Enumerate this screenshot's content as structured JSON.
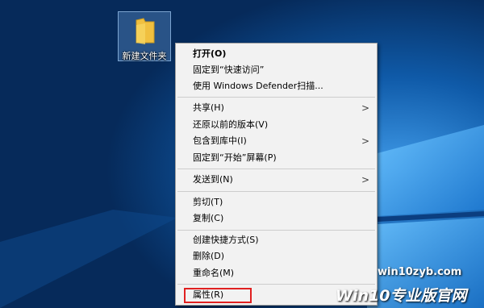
{
  "desktop": {
    "icon_label": "新建文件夹"
  },
  "context_menu": {
    "items": [
      {
        "label": "打开(O)"
      },
      {
        "label": "固定到“快速访问”"
      },
      {
        "label": "使用 Windows Defender扫描..."
      },
      {
        "label": "共享(H)"
      },
      {
        "label": "还原以前的版本(V)"
      },
      {
        "label": "包含到库中(I)"
      },
      {
        "label": "固定到“开始”屏幕(P)"
      },
      {
        "label": "发送到(N)"
      },
      {
        "label": "剪切(T)"
      },
      {
        "label": "复制(C)"
      },
      {
        "label": "创建快捷方式(S)"
      },
      {
        "label": "删除(D)"
      },
      {
        "label": "重命名(M)"
      },
      {
        "label": "属性(R)"
      }
    ],
    "submenu_arrow": ">"
  },
  "watermark": {
    "url": "win10zyb.com",
    "brand": "Win10专业版官网"
  },
  "colors": {
    "highlight_box": "#e02020",
    "folder": "#f0c040"
  }
}
